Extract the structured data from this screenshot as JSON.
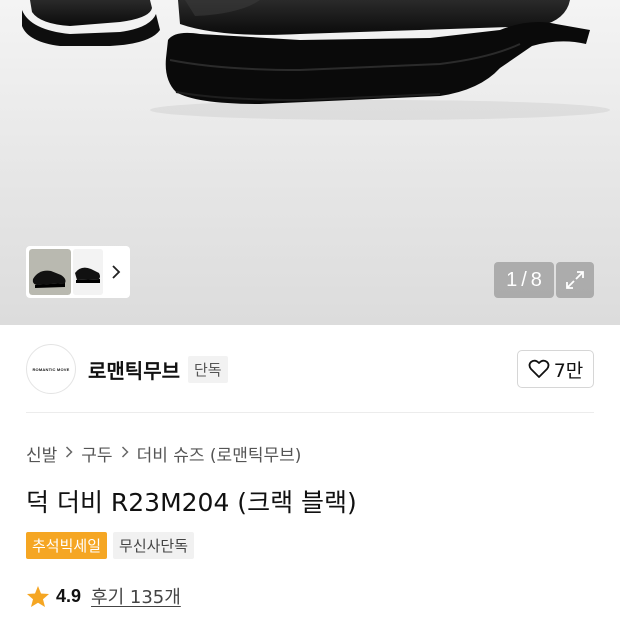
{
  "gallery": {
    "current_index": "1",
    "separator": "/",
    "total": "8"
  },
  "brand": {
    "logo_text": "ROMANTIC MOVE",
    "name": "로맨틱무브",
    "tag": "단독",
    "likes": "7만"
  },
  "breadcrumb": [
    {
      "label": "신발"
    },
    {
      "label": "구두"
    },
    {
      "label": "더비 슈즈 (로맨틱무브)"
    }
  ],
  "product": {
    "title": "덕 더비 R23M204 (크랙 블랙)"
  },
  "badges": {
    "sale": "추석빅세일",
    "exclusive": "무신사단독"
  },
  "rating": {
    "score": "4.9",
    "reviews": "후기 135개"
  },
  "colors": {
    "sale_badge": "#f5a623",
    "star": "#f5a623",
    "shoe": "#111111"
  },
  "icons": {
    "thumb_next": "chevron-right-icon",
    "expand": "expand-icon",
    "like": "heart-icon",
    "breadcrumb_sep": "chevron-right-icon",
    "rating": "star-icon"
  }
}
